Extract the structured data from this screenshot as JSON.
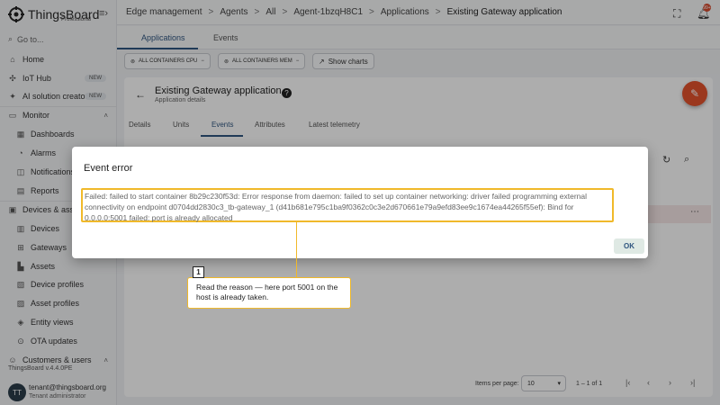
{
  "brand": {
    "name": "ThingsBoard",
    "edition": "Professional"
  },
  "sidebar": {
    "goto": "Go to...",
    "items": [
      {
        "label": "Home",
        "icon": "home-icon"
      },
      {
        "label": "IoT Hub",
        "icon": "hub-icon",
        "badge": "NEW"
      },
      {
        "label": "AI solution creator",
        "icon": "ai-icon",
        "badge": "NEW"
      },
      {
        "label": "Monitor",
        "icon": "monitor-icon"
      },
      {
        "label": "Dashboards",
        "icon": "dashboards-icon"
      },
      {
        "label": "Alarms",
        "icon": "alarms-icon"
      },
      {
        "label": "Notifications",
        "icon": "notifications-icon"
      },
      {
        "label": "Reports",
        "icon": "reports-icon"
      },
      {
        "label": "Devices & assets",
        "icon": "devices-assets-icon"
      },
      {
        "label": "Devices",
        "icon": "devices-icon"
      },
      {
        "label": "Gateways",
        "icon": "gateways-icon"
      },
      {
        "label": "Assets",
        "icon": "assets-icon"
      },
      {
        "label": "Device profiles",
        "icon": "device-profiles-icon"
      },
      {
        "label": "Asset profiles",
        "icon": "asset-profiles-icon"
      },
      {
        "label": "Entity views",
        "icon": "entity-views-icon"
      },
      {
        "label": "OTA updates",
        "icon": "ota-icon"
      },
      {
        "label": "Customers & users",
        "icon": "customers-icon"
      }
    ],
    "version": "ThingsBoard v.4.4.0PE",
    "user": {
      "initials": "TT",
      "email": "tenant@thingsboard.org",
      "role": "Tenant administrator"
    }
  },
  "breadcrumb": [
    "Edge management",
    "Agents",
    "All",
    "Agent-1bzqH8C1",
    "Applications",
    "Existing Gateway application"
  ],
  "header": {
    "notification_count": "99+"
  },
  "main_tabs": [
    "Applications",
    "Events"
  ],
  "chips": {
    "cpu": "ALL CONTAINERS CPU",
    "mem": "ALL CONTAINERS MEM",
    "charts": "Show charts"
  },
  "details": {
    "title": "Existing Gateway application",
    "subtitle": "Application details",
    "tabs": [
      "Details",
      "Units",
      "Events",
      "Attributes",
      "Latest telemetry"
    ],
    "active_tab": "Events"
  },
  "pagination": {
    "items_per_page_label": "Items per page:",
    "items_per_page": "10",
    "range": "1 – 1 of 1"
  },
  "dialog": {
    "title": "Event error",
    "message": "Failed: failed to start container 8b29c230f53d: Error response from daemon: failed to set up container networking: driver failed programming external connectivity on endpoint d0704dd2830c3_tb-gateway_1 (d41b681e795c1ba9f0362c0c3e2d670661e79a9efd83ee9c1674ea44265f55ef): Bind for 0.0.0.0:5001 failed: port is already allocated",
    "ok_label": "OK"
  },
  "callout": {
    "number": "1",
    "text": "Read the reason — here port 5001 on the host is already taken."
  },
  "colors": {
    "accent": "#305680",
    "fab": "#e5532d",
    "highlight": "#f0b92a"
  }
}
